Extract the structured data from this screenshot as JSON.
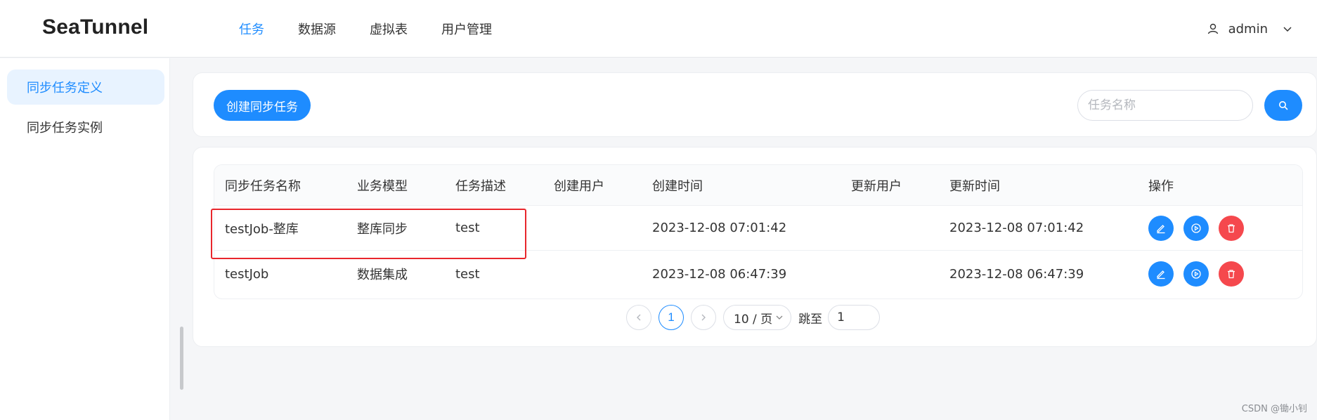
{
  "app": {
    "logo": "SeaTunnel"
  },
  "nav": {
    "items": [
      {
        "label": "任务",
        "active": true
      },
      {
        "label": "数据源",
        "active": false
      },
      {
        "label": "虚拟表",
        "active": false
      },
      {
        "label": "用户管理",
        "active": false
      }
    ]
  },
  "user": {
    "name": "admin",
    "icon": "user-icon"
  },
  "sidebar": {
    "items": [
      {
        "label": "同步任务定义",
        "active": true
      },
      {
        "label": "同步任务实例",
        "active": false
      }
    ]
  },
  "toolbar": {
    "create_label": "创建同步任务",
    "search_placeholder": "任务名称",
    "search_value": ""
  },
  "table": {
    "columns": [
      "同步任务名称",
      "业务模型",
      "任务描述",
      "创建用户",
      "创建时间",
      "更新用户",
      "更新时间",
      "操作"
    ],
    "rows": [
      {
        "name": "testJob-整库",
        "model": "整库同步",
        "desc": "test",
        "creator": "",
        "created": "2023-12-08 07:01:42",
        "updater": "",
        "updated": "2023-12-08 07:01:42"
      },
      {
        "name": "testJob",
        "model": "数据集成",
        "desc": "test",
        "creator": "",
        "created": "2023-12-08 06:47:39",
        "updater": "",
        "updated": "2023-12-08 06:47:39"
      }
    ],
    "action_icons": [
      "edit-icon",
      "run-icon",
      "delete-icon"
    ]
  },
  "pagination": {
    "current_page": "1",
    "page_size": "10 / 页",
    "jump_label": "跳至",
    "jump_value": "1"
  },
  "watermark": "CSDN @锄小钊",
  "colors": {
    "primary": "#1e8cff",
    "danger": "#f5484d",
    "highlight": "#e8262c"
  }
}
